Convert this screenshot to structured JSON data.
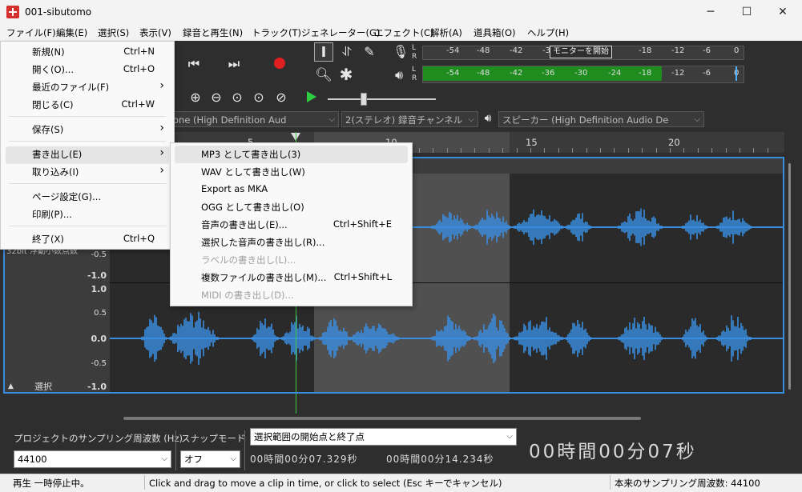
{
  "window": {
    "title": "001-sibutomo",
    "minimize": "─",
    "maximize": "☐",
    "close": "✕",
    "accent": "#3a8dde"
  },
  "menubar": [
    "ファイル(F)",
    "編集(E)",
    "選択(S)",
    "表示(V)",
    "録音と再生(N)",
    "トラック(T)",
    "ジェネレーター(G)",
    "エフェクト(C)",
    "解析(A)",
    "道具箱(O)",
    "ヘルプ(H)"
  ],
  "file_menu": [
    {
      "label": "新規(N)",
      "accel": "Ctrl+N"
    },
    {
      "label": "開く(O)...",
      "accel": "Ctrl+O"
    },
    {
      "label": "最近のファイル(F)",
      "accel": "›"
    },
    {
      "label": "閉じる(C)",
      "accel": "Ctrl+W"
    },
    {
      "label": "保存(S)",
      "accel": "›"
    },
    {
      "label": "書き出し(E)",
      "accel": "›"
    },
    {
      "label": "取り込み(I)",
      "accel": "›"
    },
    {
      "label": "ページ設定(G)...",
      "accel": ""
    },
    {
      "label": "印刷(P)...",
      "accel": ""
    },
    {
      "label": "終了(X)",
      "accel": "Ctrl+Q"
    }
  ],
  "export_menu": [
    {
      "label": "MP3 として書き出し(3)",
      "accel": ""
    },
    {
      "label": "WAV として書き出し(W)",
      "accel": ""
    },
    {
      "label": "Export as MKA",
      "accel": ""
    },
    {
      "label": "OGG として書き出し(O)",
      "accel": ""
    },
    {
      "label": "音声の書き出し(E)...",
      "accel": "Ctrl+Shift+E"
    },
    {
      "label": "選択した音声の書き出し(R)...",
      "accel": ""
    },
    {
      "label": "ラベルの書き出し(L)...",
      "accel": ""
    },
    {
      "label": "複数ファイルの書き出し(M)...",
      "accel": "Ctrl+Shift+L"
    },
    {
      "label": "MIDI の書き出し(D)...",
      "accel": ""
    }
  ],
  "meters": {
    "monitor_label": "モニターを開始",
    "scale": [
      "-54",
      "-48",
      "-42",
      "-36",
      "-30",
      "-24",
      "-18",
      "-12",
      "-6",
      "0"
    ],
    "record_scale": [
      "-54",
      "-48",
      "-42",
      "-3",
      "-18",
      "-12",
      "-6",
      "0"
    ],
    "L": "L",
    "R": "R",
    "play_level_color": "#1e8c1e"
  },
  "devices": {
    "mic": "one (High Definition Aud",
    "channels": "2(ステレオ) 録音チャンネル",
    "speaker": "スピーカー (High Definition Audio De"
  },
  "ruler": {
    "ticks": [
      "5",
      "10",
      "15",
      "20"
    ]
  },
  "track": {
    "name_fragment": "32bit 浮動小数点数",
    "select_button": "選択",
    "scale_top": [
      "-0.5",
      "-1.0"
    ],
    "scale_bottom": [
      "1.0",
      "0.5",
      "0.0",
      "-0.5",
      "-1.0"
    ],
    "wave_color": "#3a8dde"
  },
  "selection_bar": {
    "rate_label": "プロジェクトのサンプリング周波数 (Hz)",
    "snap_label": "スナップモード",
    "range_mode": "選択範囲の開始点と終了点",
    "rate_value": "44100",
    "snap_value": "オフ",
    "start_time": "00時間00分07.329秒",
    "end_time": "00時間00分14.234秒",
    "big_time": "00時間00分07秒"
  },
  "status": {
    "state": "再生 一時停止中。",
    "hint": "Click and drag to move a clip in time, or click to select (Esc キーでキャンセル)",
    "rate": "本来のサンプリング周波数: 44100"
  }
}
